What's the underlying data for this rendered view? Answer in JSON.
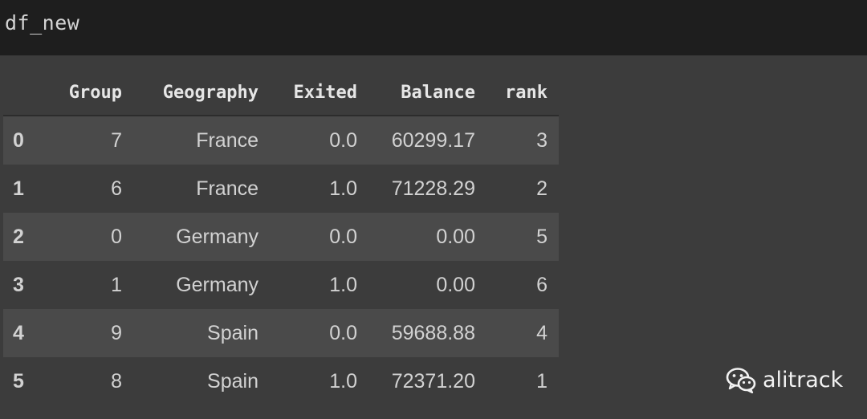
{
  "code_cell": {
    "code": "df_new"
  },
  "dataframe": {
    "columns": [
      "Group",
      "Geography",
      "Exited",
      "Balance",
      "rank"
    ],
    "rows": [
      {
        "index": "0",
        "Group": "7",
        "Geography": "France",
        "Exited": "0.0",
        "Balance": "60299.17",
        "rank": "3"
      },
      {
        "index": "1",
        "Group": "6",
        "Geography": "France",
        "Exited": "1.0",
        "Balance": "71228.29",
        "rank": "2"
      },
      {
        "index": "2",
        "Group": "0",
        "Geography": "Germany",
        "Exited": "0.0",
        "Balance": "0.00",
        "rank": "5"
      },
      {
        "index": "3",
        "Group": "1",
        "Geography": "Germany",
        "Exited": "1.0",
        "Balance": "0.00",
        "rank": "6"
      },
      {
        "index": "4",
        "Group": "9",
        "Geography": "Spain",
        "Exited": "0.0",
        "Balance": "59688.88",
        "rank": "4"
      },
      {
        "index": "5",
        "Group": "8",
        "Geography": "Spain",
        "Exited": "1.0",
        "Balance": "72371.20",
        "rank": "1"
      }
    ]
  },
  "watermark": {
    "icon": "wechat-icon",
    "text": "alitrack"
  },
  "colors": {
    "code_background": "#1e1e1e",
    "output_background": "#3c3c3c",
    "striped_row": "#4a4a4a"
  }
}
